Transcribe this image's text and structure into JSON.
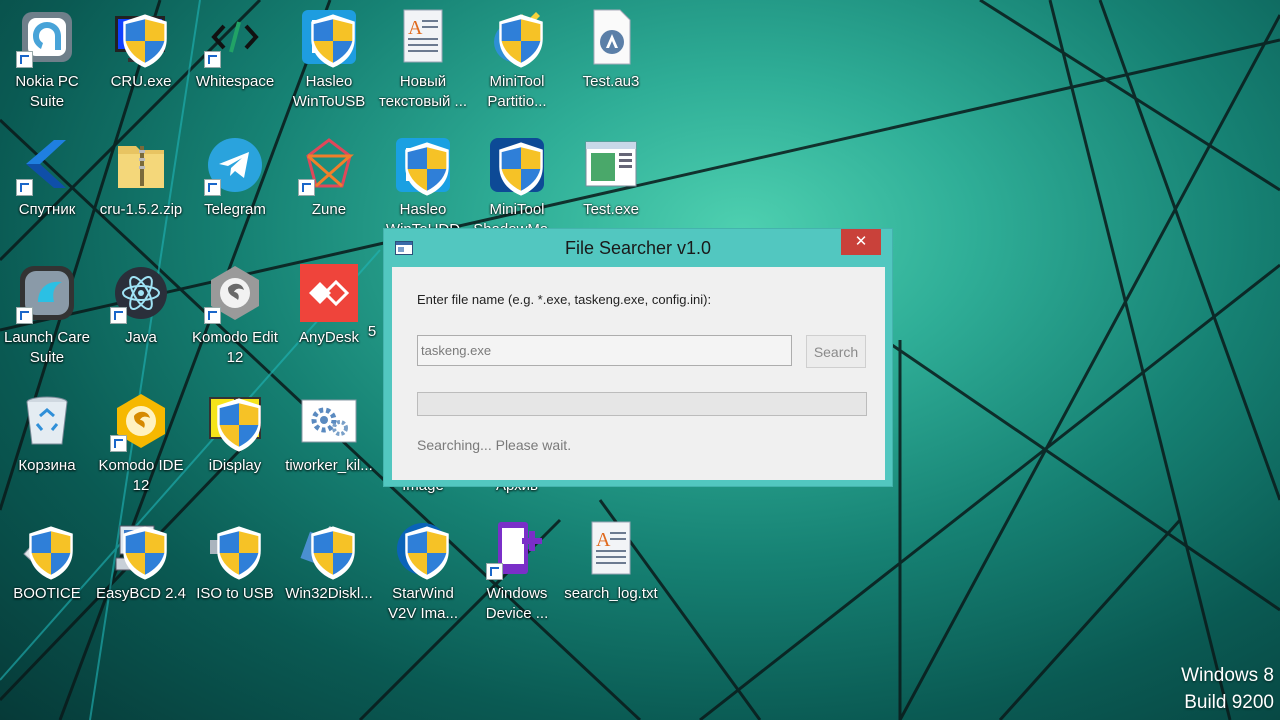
{
  "desktop": {
    "icons": [
      {
        "label": "Nokia PC\nSuite",
        "icon": "nokia-pc-suite-icon"
      },
      {
        "label": "CRU.exe",
        "icon": "monitor-icon"
      },
      {
        "label": "Whitespace",
        "icon": "code-brackets-icon"
      },
      {
        "label": "Hasleo\nWinToUSB",
        "icon": "wintousb-icon"
      },
      {
        "label": "Новый\nтекстовый ...",
        "icon": "text-document-icon"
      },
      {
        "label": "MiniTool\nPartitio...",
        "icon": "minitool-partition-icon"
      },
      {
        "label": "Test.au3",
        "icon": "autoit-script-icon"
      },
      {
        "label": "Спутник",
        "icon": "sputnik-icon"
      },
      {
        "label": "cru-1.5.2.zip",
        "icon": "zip-folder-icon"
      },
      {
        "label": "Telegram",
        "icon": "telegram-icon"
      },
      {
        "label": "Zune",
        "icon": "zune-icon"
      },
      {
        "label": "Hasleo\nWinToHDD",
        "icon": "wintohdd-icon"
      },
      {
        "label": "MiniTool\nShadowMa...",
        "icon": "shadowmaker-icon"
      },
      {
        "label": "Test.exe",
        "icon": "exe-window-icon"
      },
      {
        "label": "Launch Care\nSuite",
        "icon": "launch-care-suite-icon"
      },
      {
        "label": "Java",
        "icon": "java-atom-icon"
      },
      {
        "label": "Komodo Edit\n12",
        "icon": "komodo-edit-icon"
      },
      {
        "label": "AnyDesk",
        "icon": "anydesk-icon"
      },
      {
        "label": "Корзина",
        "icon": "recycle-bin-icon"
      },
      {
        "label": "Komodo IDE\n12",
        "icon": "komodo-ide-icon"
      },
      {
        "label": "iDisplay",
        "icon": "idisplay-icon"
      },
      {
        "label": "tiworker_kil...",
        "icon": "settings-gears-icon"
      },
      {
        "label": "BOOTICE",
        "icon": "bootice-icon"
      },
      {
        "label": "EasyBCD 2.4",
        "icon": "easybcd-icon"
      },
      {
        "label": "ISO to USB",
        "icon": "usb-drive-icon"
      },
      {
        "label": "Win32Diskl...",
        "icon": "win32diskimager-icon"
      },
      {
        "label": "StarWind\nV2V Ima...",
        "icon": "starwind-icon"
      },
      {
        "label": "Windows\nDevice ...",
        "icon": "windows-device-portal-icon"
      },
      {
        "label": "search_log.txt",
        "icon": "text-log-icon"
      }
    ],
    "partial_labels": [
      "5",
      "Image",
      "Архив"
    ]
  },
  "dialog": {
    "title": "File Searcher v1.0",
    "close_label": "✕",
    "prompt": "Enter file name (e.g. *.exe, taskeng.exe, config.ini):",
    "input_value": "taskeng.exe",
    "search_button": "Search",
    "progress": 0,
    "status": "Searching... Please wait."
  },
  "watermark": {
    "line1": "Windows 8",
    "line2": "Build 9200"
  },
  "colors": {
    "dialog_frame": "#52c7c0",
    "close_button": "#c9413a",
    "desktop_accent": "#2fae97"
  }
}
